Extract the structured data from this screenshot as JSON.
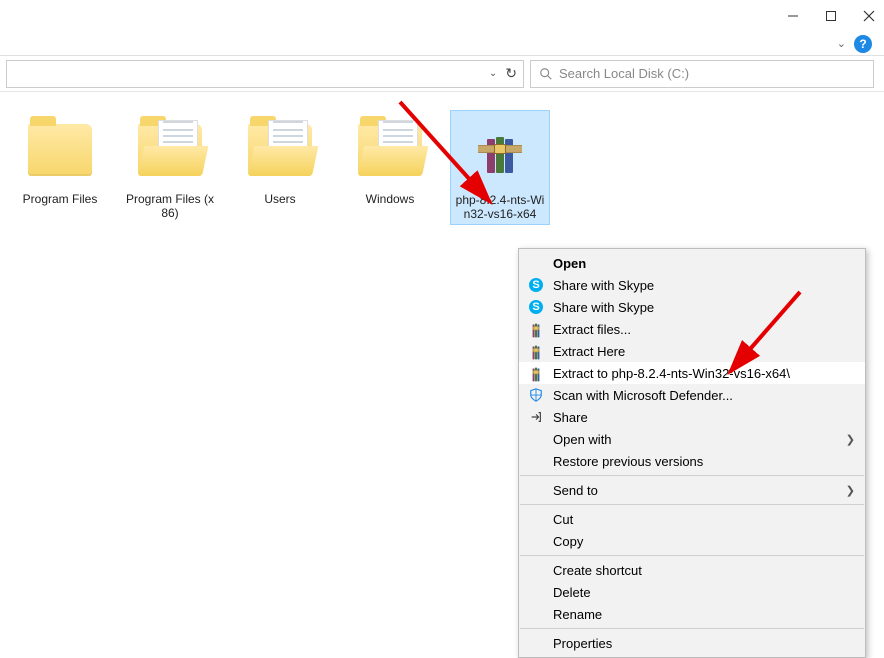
{
  "window": {
    "minimize_label": "Minimize",
    "maximize_label": "Maximize",
    "close_label": "Close"
  },
  "addressbar": {
    "search_placeholder": "Search Local Disk (C:)"
  },
  "items": [
    {
      "label": "Program Files",
      "type": "folder-closed"
    },
    {
      "label": "Program Files (x86)",
      "type": "folder-open"
    },
    {
      "label": "Users",
      "type": "folder-open"
    },
    {
      "label": "Windows",
      "type": "folder-open"
    },
    {
      "label": "php-8.2.4-nts-Win32-vs16-x64",
      "type": "rar",
      "selected": true
    }
  ],
  "contextmenu": {
    "open": "Open",
    "share_skype_1": "Share with Skype",
    "share_skype_2": "Share with Skype",
    "extract_files": "Extract files...",
    "extract_here": "Extract Here",
    "extract_to": "Extract to php-8.2.4-nts-Win32-vs16-x64\\",
    "scan_defender": "Scan with Microsoft Defender...",
    "share": "Share",
    "open_with": "Open with",
    "restore": "Restore previous versions",
    "send_to": "Send to",
    "cut": "Cut",
    "copy": "Copy",
    "create_shortcut": "Create shortcut",
    "delete": "Delete",
    "rename": "Rename",
    "properties": "Properties"
  }
}
